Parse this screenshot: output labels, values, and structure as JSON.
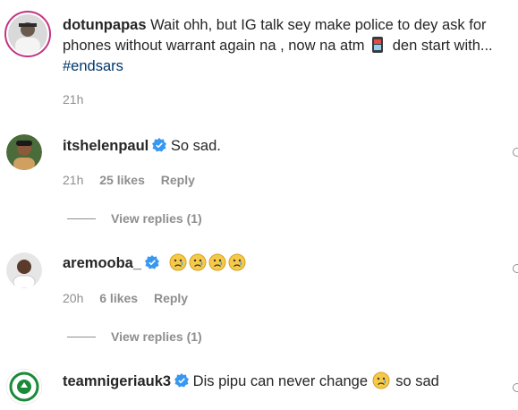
{
  "post": {
    "username": "dotunpapas",
    "text_before_emoji": "Wait ohh, but IG talk sey make police to dey ask for phones without warrant again na , now na atm",
    "phone_emoji": "phone-emoji",
    "text_after_emoji": "den start with...",
    "hashtag": "#endsars",
    "time": "21h"
  },
  "comments": [
    {
      "username": "itshelenpaul",
      "verified": true,
      "text": "So sad.",
      "time": "21h",
      "likes": "25 likes",
      "reply": "Reply",
      "view_replies": "View replies (1)"
    },
    {
      "username": "aremooba_",
      "verified": true,
      "emoji_count": 4,
      "time": "20h",
      "likes": "6 likes",
      "reply": "Reply",
      "view_replies": "View replies (1)"
    },
    {
      "username": "teamnigeriauk3",
      "verified": true,
      "text_before": "Dis pipu can never change",
      "text_after": "so sad"
    }
  ],
  "colors": {
    "verified": "#3897f0",
    "hashtag": "#00376b",
    "meta": "#8e8e8e"
  }
}
